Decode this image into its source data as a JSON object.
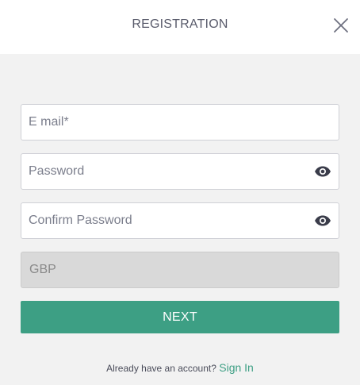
{
  "header": {
    "title": "REGISTRATION",
    "close_icon": "close-icon"
  },
  "form": {
    "email": {
      "placeholder": "E mail*",
      "value": ""
    },
    "password": {
      "placeholder": "Password",
      "value": "",
      "icon": "eye-icon"
    },
    "confirm_password": {
      "placeholder": "Confirm Password",
      "value": "",
      "icon": "eye-icon"
    },
    "currency": {
      "value": "GBP"
    },
    "next_label": "NEXT"
  },
  "footer": {
    "prompt": "Already have an account?",
    "sign_in_label": "Sign In"
  },
  "colors": {
    "accent": "#3d9f84",
    "background": "#f2f2f2",
    "disabled_field": "#d9d9d9"
  }
}
